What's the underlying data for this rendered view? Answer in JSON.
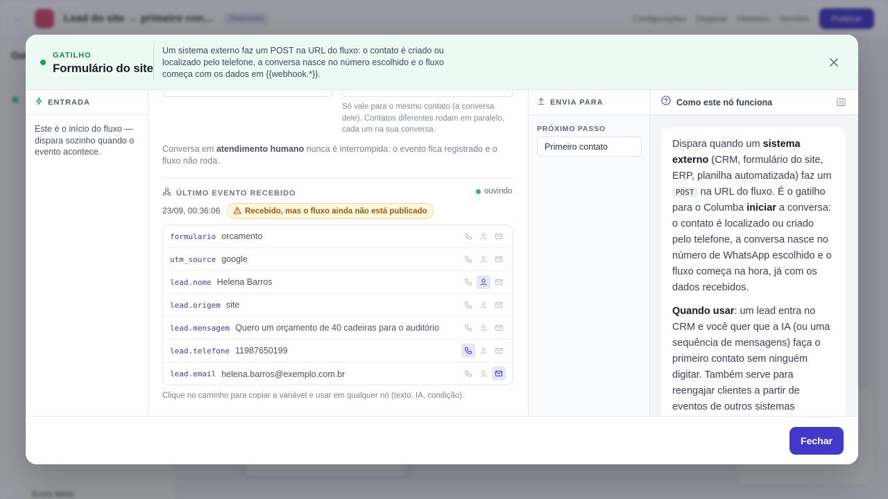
{
  "background": {
    "app_title": "Lead do site → primeiro con…",
    "status_chip": "Rascunho",
    "top_links": [
      "Configurações",
      "Disparar",
      "Histórico",
      "Versões"
    ],
    "primary_button": "Publicar",
    "sidebar_title": "Gat",
    "canvas_label": "Envio Meta"
  },
  "modal": {
    "header": {
      "kicker": "GATILHO",
      "title": "Formulário do site",
      "description": "Um sistema externo faz um POST na URL do fluxo: o contato é criado ou localizado pelo telefone, a conversa nasce no número escolhido e o fluxo começa com os dados em {{webhook.*}}."
    },
    "left": {
      "heading": "ENTRADA",
      "text": "Este é o início do fluxo — dispara sozinho quando o evento acontece."
    },
    "middle": {
      "scope_note": "Só vale para o mesmo contato (a conversa dele). Contatos diferentes rodam em paralelo, cada um na sua conversa.",
      "human_prefix": "Conversa em ",
      "human_bold": "atendimento humano",
      "human_suffix": " nunca é interrompida: o evento fica registrado e o fluxo não roda.",
      "event_heading": "ÚLTIMO EVENTO RECEBIDO",
      "listening": "ouvindo",
      "event_time": "23/09, 00:36:06",
      "warning_badge": "Recebido, mas o fluxo ainda não está publicado",
      "rows": [
        {
          "key": "formulario",
          "value": "orcamento",
          "active": ""
        },
        {
          "key": "utm_source",
          "value": "google",
          "active": ""
        },
        {
          "key": "lead.nome",
          "value": "Helena Barros",
          "active": "person"
        },
        {
          "key": "lead.origem",
          "value": "site",
          "active": ""
        },
        {
          "key": "lead.mensagem",
          "value": "Quero um orçamento de 40 cadeiras para o auditório",
          "active": ""
        },
        {
          "key": "lead.telefone",
          "value": "11987650199",
          "active": "phone"
        },
        {
          "key": "lead.email",
          "value": "helena.barros@exemplo.com.br",
          "active": "mail"
        }
      ],
      "footer_hint": "Clique no caminho para copiar a variável e usar em qualquer nó (texto, IA, condição)."
    },
    "sends_to": {
      "heading": "ENVIA PARA",
      "next_step_label": "PRÓXIMO PASSO",
      "next_step_value": "Primeiro contato"
    },
    "help": {
      "heading": "Como este nó funciona",
      "p1_a": "Dispara quando um ",
      "p1_b": "sistema externo",
      "p1_c": " (CRM, formulário do site, ERP, planilha automatizada) faz um ",
      "p1_code": "POST",
      "p1_d": " na URL do fluxo. É o gatilho para o Columba ",
      "p1_e": "iniciar",
      "p1_f": " a conversa: o contato é localizado ou criado pelo telefone, a conversa nasce no número de WhatsApp escolhido e o fluxo começa na hora, já com os dados recebidos.",
      "p2_a": "Quando usar",
      "p2_b": ": um lead entra no CRM e você quer que a IA (ou uma sequência de mensagens) faça o primeiro contato sem ninguém digitar. Também serve para reengajar clientes a partir de eventos de outros sistemas"
    },
    "footer": {
      "close_button": "Fechar"
    },
    "colors": {
      "accent": "#4338ca",
      "trigger_green": "#16a34a",
      "warning_bg": "#fff8e1"
    }
  }
}
